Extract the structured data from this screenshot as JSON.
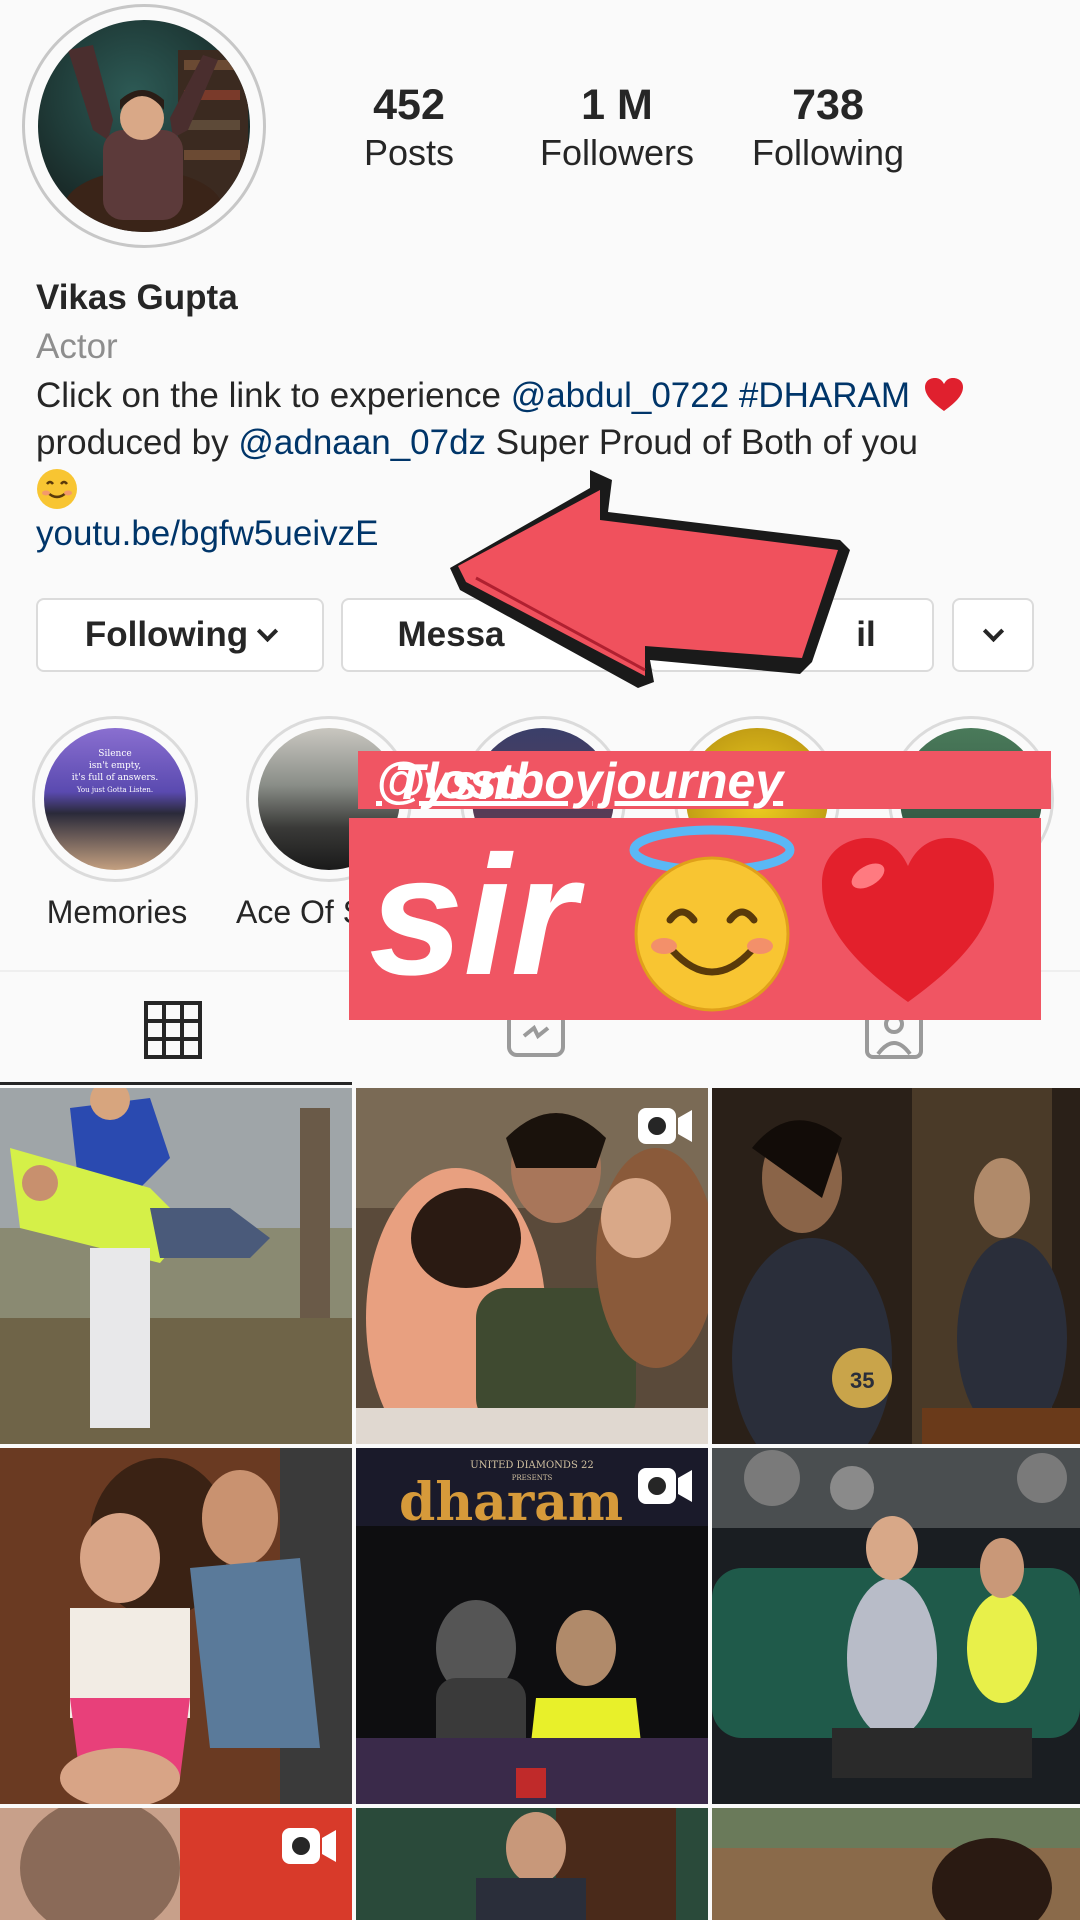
{
  "profile": {
    "stats": [
      {
        "value": "452",
        "label": "Posts"
      },
      {
        "value": "1 M",
        "label": "Followers"
      },
      {
        "value": "738",
        "label": "Following"
      }
    ],
    "name": "Vikas Gupta",
    "category": "Actor",
    "bio_prefix": "Click on the link to experience ",
    "bio_mention1": "@abdul_0722",
    "bio_hashtag": "#DHARAM",
    "bio_mid": "produced by ",
    "bio_mention2": "@adnaan_07dz",
    "bio_suffix": " Super Proud of Both of you",
    "website": "youtu.be/bgfw5ueivzE"
  },
  "buttons": {
    "following": "Following",
    "message": "Messa",
    "email": "il"
  },
  "highlights": [
    {
      "label": "Memories",
      "caption_lines": [
        "Silence",
        "isn't empty,",
        "it's full of answers.",
        "You just Gotta Listen."
      ]
    },
    {
      "label": "Ace Of S"
    }
  ],
  "grid": {
    "dharam_title": "dharam",
    "dharam_presenter": "UNITED DIAMONDS 22",
    "dharam_presents": "PRESENTS",
    "jersey_number": "35"
  },
  "story_overlay": {
    "mention_prefix": "Tysm ",
    "mention": "@lostboyjourney",
    "big_text": "sir"
  },
  "colors": {
    "link": "#003569",
    "banner": "#f05563",
    "arrow": "#f0515d"
  }
}
